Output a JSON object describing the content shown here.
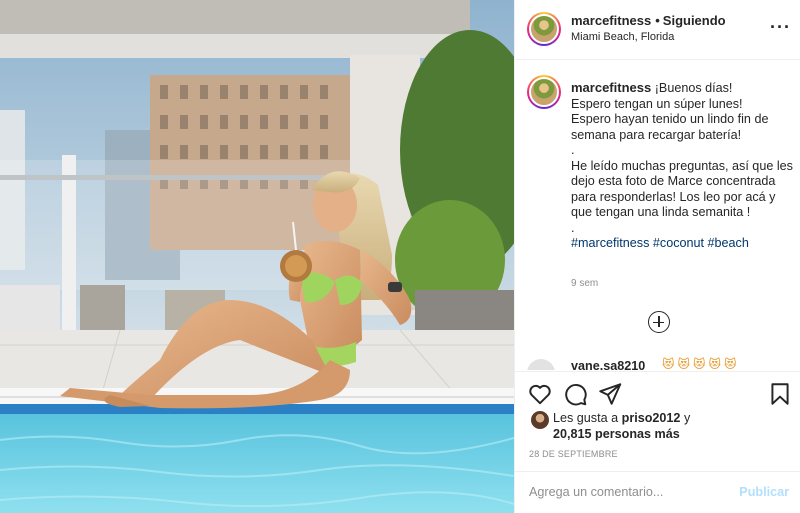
{
  "post": {
    "author": "marcefitness",
    "follow_status": "Siguiendo",
    "location": "Miami Beach, Florida",
    "more_icon": "more-horizontal-icon",
    "image_alt": "Mujer con bikini verde sentada junto a la piscina sosteniendo un coco"
  },
  "caption": {
    "username": "marcefitness",
    "lines": [
      "¡Buenos días!",
      "Espero tengan un súper lunes!",
      "Espero hayan tenido un lindo fin de semana para recargar batería!",
      ".",
      "He leído muchas preguntas, así que les dejo esta foto de Marce concentrada para responderlas! Los leo por acá y que tengan una linda semanita !",
      "."
    ],
    "hashtags": [
      "#marcefitness",
      "#coconut",
      "#beach"
    ],
    "time_ago": "9 sem"
  },
  "comments": {
    "load_more_icon": "plus-circle-icon",
    "next": {
      "username": "vane.sa8210",
      "emojis": "😻😻😻😻😻"
    }
  },
  "actions": {
    "icons": [
      "heart-icon",
      "comment-icon",
      "share-icon",
      "bookmark-icon"
    ]
  },
  "likes": {
    "prefix": "Les gusta a",
    "user": "priso2012",
    "connector": "y",
    "others": "20,815 personas más"
  },
  "date": "28 DE SEPTIEMBRE",
  "comment_box": {
    "placeholder": "Agrega un comentario...",
    "publish_label": "Publicar"
  },
  "colors": {
    "text": "#262626",
    "muted": "#8e8e8e",
    "link": "#00376b",
    "publish_disabled": "#b2dffc",
    "border": "#efefef"
  }
}
